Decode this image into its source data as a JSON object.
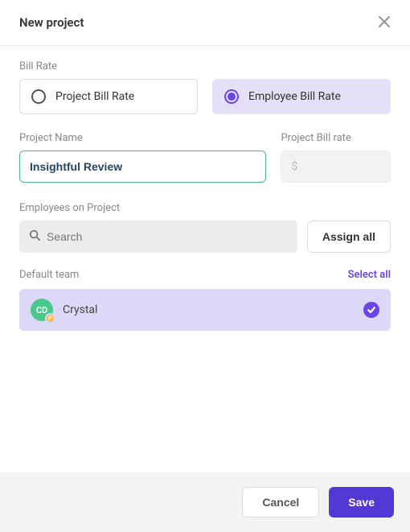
{
  "header": {
    "title": "New project"
  },
  "billRate": {
    "label": "Bill Rate",
    "options": {
      "project": "Project Bill Rate",
      "employee": "Employee Bill Rate"
    }
  },
  "projectName": {
    "label": "Project Name",
    "value": "Insightful Review"
  },
  "projectBillRate": {
    "label": "Project Bill rate",
    "placeholder": "$"
  },
  "employees": {
    "label": "Employees on Project",
    "search_placeholder": "Search",
    "assign_all": "Assign all"
  },
  "team": {
    "name": "Default team",
    "select_all": "Select all",
    "members": [
      {
        "initials": "CD",
        "name": "Crystal",
        "badge": "P",
        "selected": true
      }
    ]
  },
  "footer": {
    "cancel": "Cancel",
    "save": "Save"
  }
}
